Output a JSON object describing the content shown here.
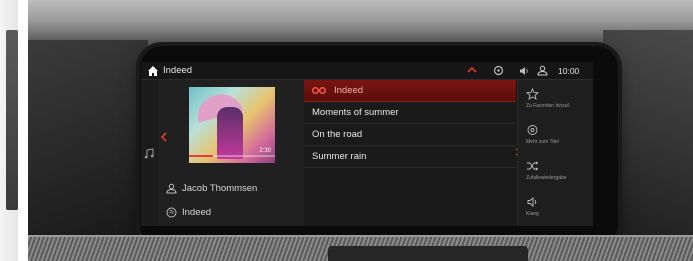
{
  "topbar": {
    "app_title": "Indeed",
    "clock": "10:00"
  },
  "now_playing": {
    "cover_time": "2:30",
    "progress": 0.28,
    "artist": "Jacob Thommsen",
    "album": "Indeed"
  },
  "tracklist": [
    {
      "title": "Indeed",
      "playing": true
    },
    {
      "title": "Moments of summer",
      "playing": false
    },
    {
      "title": "On the road",
      "playing": false
    },
    {
      "title": "Summer rain",
      "playing": false
    }
  ],
  "side_menu": [
    {
      "icon": "star-icon",
      "label": "Zu Favoriten hinzuf."
    },
    {
      "icon": "tone-icon",
      "label": "Mehr zum Titel"
    },
    {
      "icon": "shuffle-icon",
      "label": "Zufallswiedergabe"
    },
    {
      "icon": "sound-icon",
      "label": "Klang"
    }
  ],
  "colors": {
    "accent_red": "#c0221a",
    "selected_row": "#7a1510",
    "screen_bg": "#141414"
  }
}
